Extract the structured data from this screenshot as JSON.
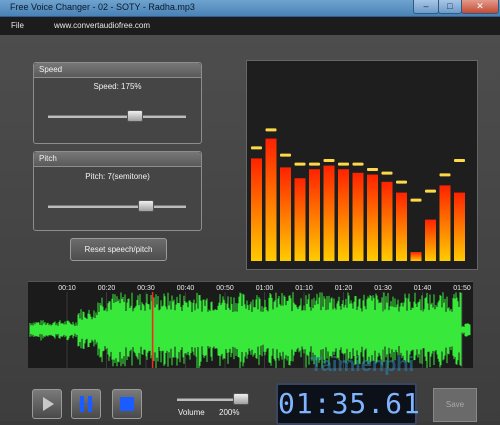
{
  "window": {
    "title": "Free Voice Changer - 02 - SOTY - Radha.mp3",
    "minimize_glyph": "–",
    "maximize_glyph": "□",
    "close_glyph": "✕"
  },
  "menu": {
    "file_label": "File",
    "website_label": "www.convertaudiofree.com"
  },
  "speed": {
    "header": "Speed",
    "value_label": "Speed: 175%",
    "slider_value": 0.62
  },
  "pitch": {
    "header": "Pitch",
    "value_label": "Pitch: 7(semitone)",
    "slider_value": 0.7
  },
  "reset_label": "Reset speech/pitch",
  "equalizer": {
    "bars": [
      0.57,
      0.68,
      0.52,
      0.46,
      0.51,
      0.53,
      0.51,
      0.49,
      0.48,
      0.44,
      0.38,
      0.05,
      0.23,
      0.42,
      0.38
    ],
    "peaks": [
      0.62,
      0.72,
      0.58,
      0.53,
      0.53,
      0.55,
      0.53,
      0.53,
      0.5,
      0.48,
      0.43,
      0.33,
      0.38,
      0.47,
      0.55
    ],
    "bar_top_color": "#ff2200",
    "bar_bottom_color": "#ffcc00",
    "peak_color": "#ffd84a"
  },
  "waveform": {
    "color": "#38e83a",
    "playhead_color": "#ff2222",
    "timestamps": [
      "00:10",
      "00:20",
      "00:30",
      "00:40",
      "00:50",
      "01:00",
      "01:10",
      "01:20",
      "01:30",
      "01:40",
      "01:50"
    ],
    "playhead_position": 0.28
  },
  "controls": {
    "play_icon": "play-icon",
    "pause_icon": "pause-icon",
    "stop_icon": "stop-icon",
    "volume_label": "Volume",
    "volume_value": "200%",
    "volume_level": 0.92
  },
  "time_display": "01:35.61",
  "save_label": "Save",
  "watermark": "Taimienphi"
}
